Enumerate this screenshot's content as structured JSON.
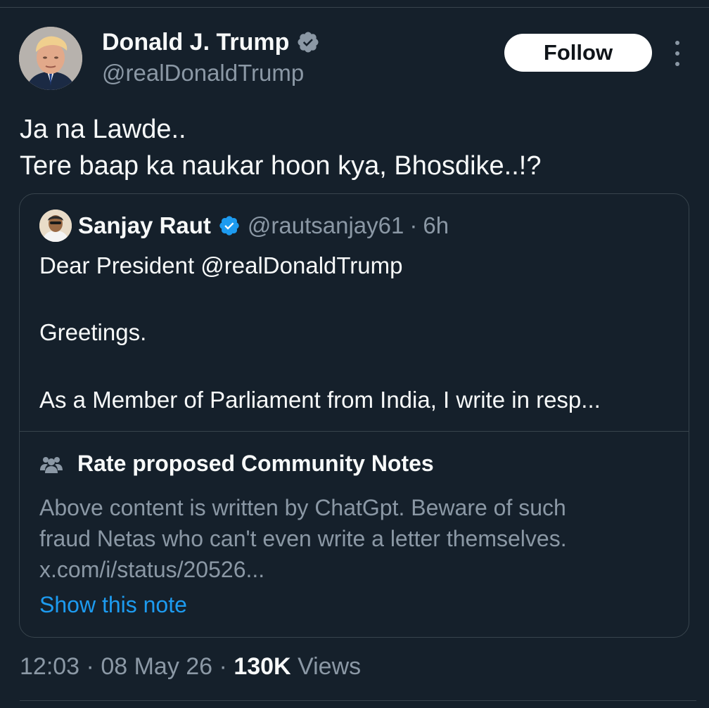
{
  "author": {
    "name": "Donald J. Trump",
    "handle": "@realDonaldTrump",
    "avatar_icon": "person-portrait-icon",
    "badge_icon": "verified-gray-badge-icon",
    "badge_color": "#8b98a5"
  },
  "follow_label": "Follow",
  "more_icon": "more-options-icon",
  "tweet": {
    "lines": [
      "Ja na Lawde..",
      "Tere baap ka naukar hoon kya, Bhosdike..!?"
    ]
  },
  "quote": {
    "name": "Sanjay Raut",
    "handle": "@rautsanjay61",
    "separator": "·",
    "time": "6h",
    "badge_icon": "verified-blue-badge-icon",
    "badge_color": "#1d9bf0",
    "lines": [
      "Dear President @realDonaldTrump",
      "Greetings.",
      "As a Member of Parliament from India, I write in resp..."
    ]
  },
  "community_notes": {
    "icon": "people-icon",
    "title": "Rate proposed Community Notes",
    "lines": [
      "Above content is written by ChatGpt. Beware of such",
      "fraud Netas who can't even write a letter themselves.",
      "x.com/i/status/20526..."
    ],
    "show_label": "Show this note",
    "link_color": "#1d9bf0"
  },
  "meta": {
    "time": "12:03",
    "separator": "·",
    "date": "08 May 26",
    "views_count": "130K",
    "views_label": "Views"
  },
  "colors": {
    "background": "#15202b",
    "border": "#38444d",
    "text_primary": "#f7f9f9",
    "text_secondary": "#8b98a5"
  }
}
